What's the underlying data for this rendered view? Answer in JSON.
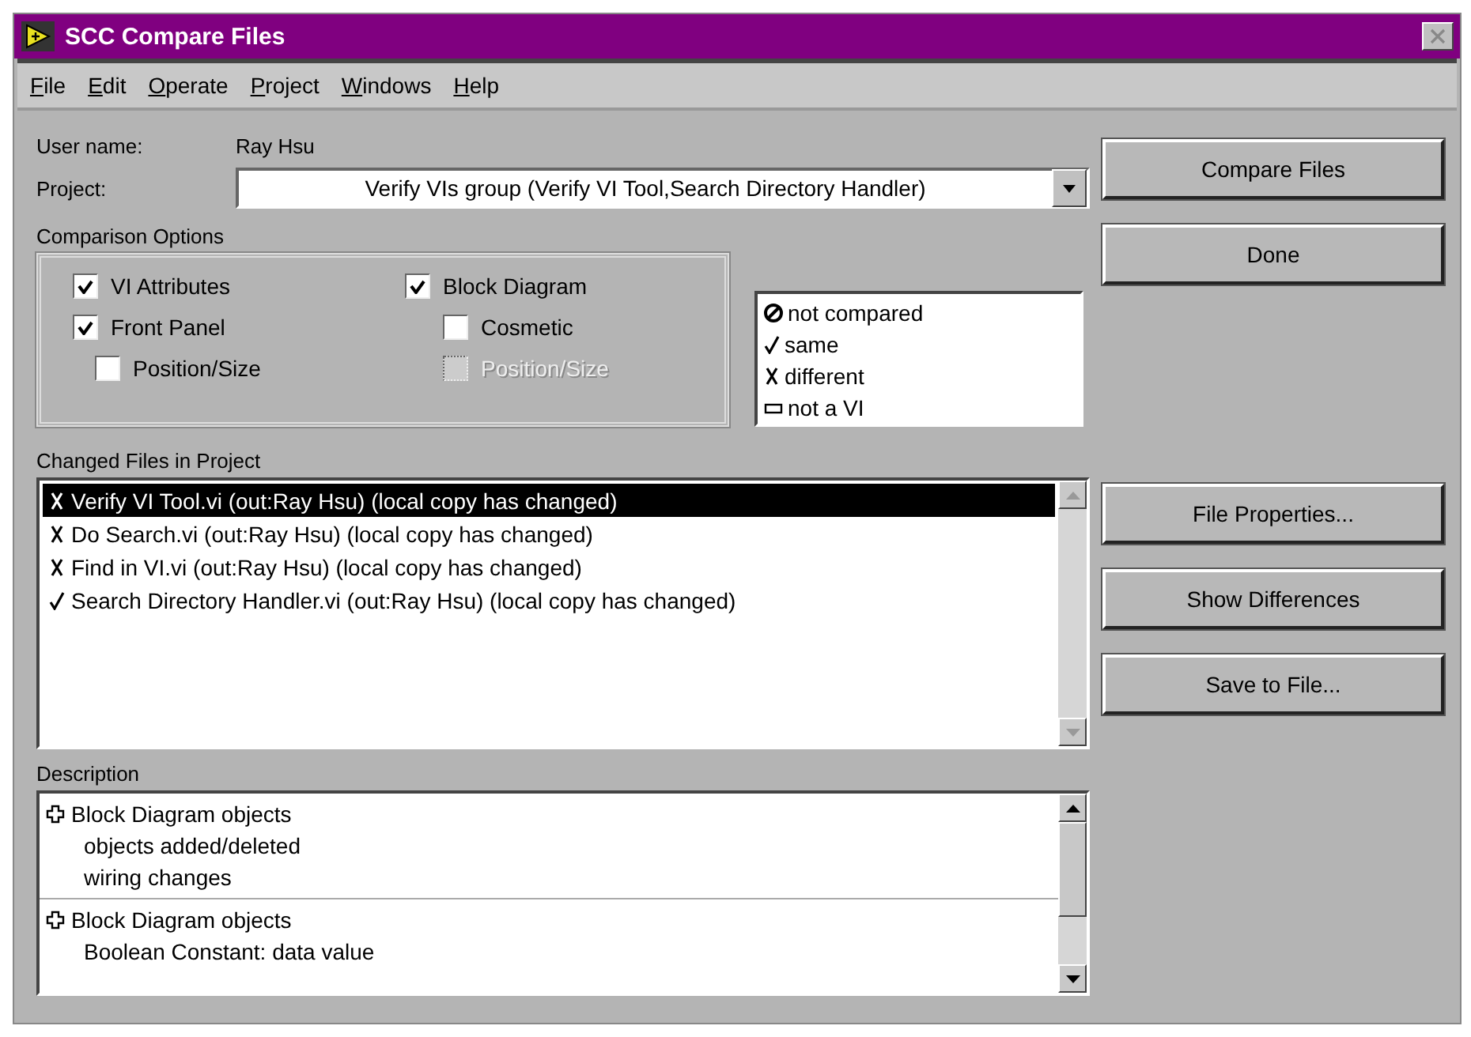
{
  "window": {
    "title": "SCC Compare Files"
  },
  "menu": [
    {
      "label": "File"
    },
    {
      "label": "Edit"
    },
    {
      "label": "Operate"
    },
    {
      "label": "Project"
    },
    {
      "label": "Windows"
    },
    {
      "label": "Help"
    }
  ],
  "user": {
    "label": "User name:",
    "value": "Ray Hsu"
  },
  "project": {
    "label": "Project:",
    "value": "Verify VIs group (Verify VI Tool,Search Directory Handler)"
  },
  "comparison_options": {
    "label": "Comparison Options",
    "columns": [
      [
        {
          "label": "VI Attributes",
          "checked": true,
          "disabled": false
        },
        {
          "label": "Front Panel",
          "checked": true,
          "disabled": false,
          "children": [
            {
              "label": "Position/Size",
              "checked": false,
              "disabled": false
            }
          ]
        }
      ],
      [
        {
          "label": "Block Diagram",
          "checked": true,
          "disabled": false,
          "children": [
            {
              "label": "Cosmetic",
              "checked": false,
              "disabled": false
            },
            {
              "label": "Position/Size",
              "checked": false,
              "disabled": true
            }
          ]
        }
      ]
    ]
  },
  "legend": [
    {
      "kind": "not_compared",
      "label": "not compared"
    },
    {
      "kind": "same",
      "label": "same"
    },
    {
      "kind": "different",
      "label": "different"
    },
    {
      "kind": "not_vi",
      "label": "not a VI"
    }
  ],
  "changed_files": {
    "label": "Changed Files in Project",
    "rows": [
      {
        "kind": "different",
        "text": "Verify VI Tool.vi (out:Ray Hsu) (local copy has changed)",
        "selected": true
      },
      {
        "kind": "different",
        "text": "Do Search.vi (out:Ray Hsu) (local copy has changed)",
        "selected": false
      },
      {
        "kind": "different",
        "text": "Find in VI.vi (out:Ray Hsu) (local copy has changed)",
        "selected": false
      },
      {
        "kind": "same",
        "text": "Search Directory Handler.vi (out:Ray Hsu) (local copy has changed)",
        "selected": false
      }
    ]
  },
  "description": {
    "label": "Description",
    "groups": [
      {
        "title": "Block Diagram objects",
        "lines": [
          "objects added/deleted",
          "wiring changes"
        ]
      },
      {
        "title": "Block Diagram objects",
        "lines": [
          "Boolean Constant: data value"
        ]
      }
    ]
  },
  "buttons_top": [
    "Compare Files",
    "Done"
  ],
  "buttons_bottom": [
    "File Properties...",
    "Show Differences",
    "Save to File..."
  ]
}
